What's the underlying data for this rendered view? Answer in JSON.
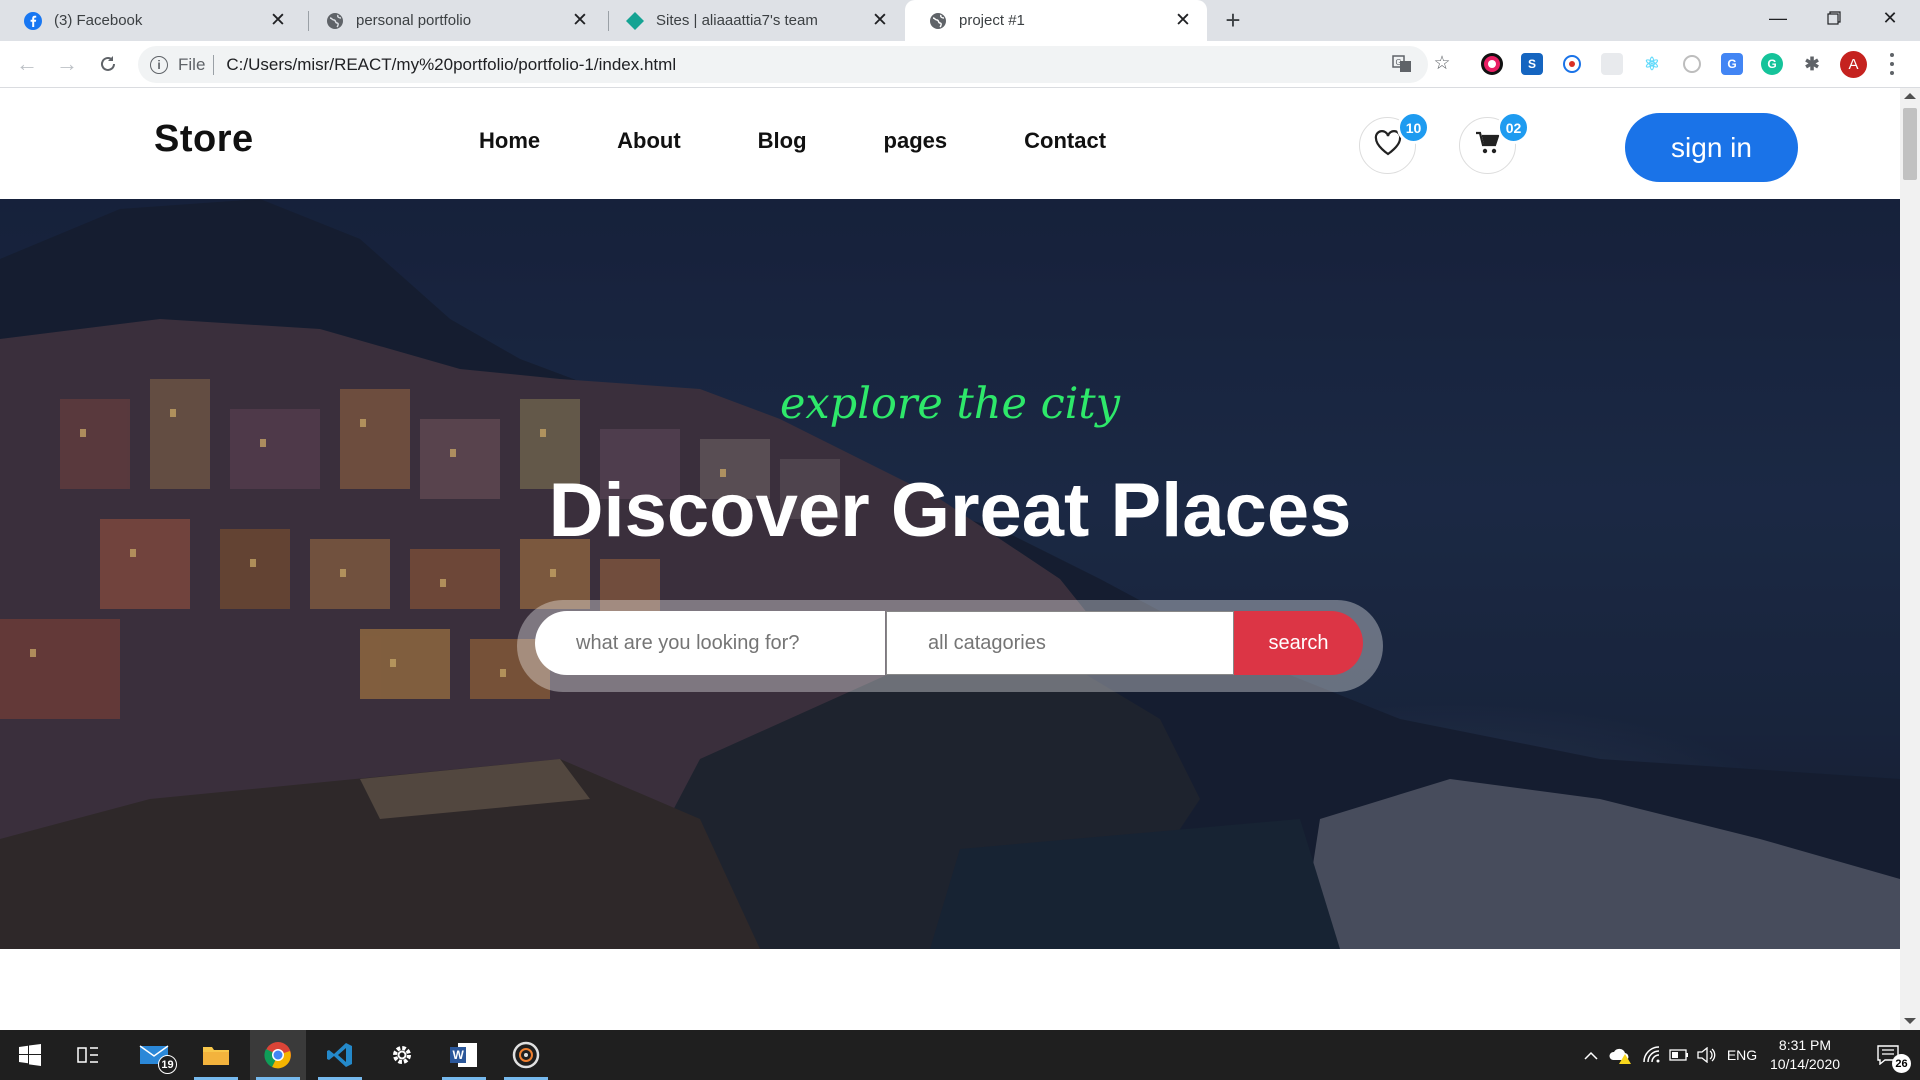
{
  "browser": {
    "tabs": [
      {
        "title": "(3) Facebook",
        "icon": "facebook-icon",
        "active": false
      },
      {
        "title": "personal portfolio",
        "icon": "globe-icon",
        "active": false
      },
      {
        "title": "Sites | aliaaattia7's team",
        "icon": "netlify-icon",
        "active": false
      },
      {
        "title": "project #1",
        "icon": "globe-icon",
        "active": true
      }
    ],
    "new_tab": "+",
    "address": {
      "scheme": "File",
      "url": "C:/Users/misr/REACT/my%20portfolio/portfolio-1/index.html"
    },
    "profile_initial": "A"
  },
  "site": {
    "logo": "Store",
    "nav": [
      "Home",
      "About",
      "Blog",
      "pages",
      "Contact"
    ],
    "wishlist_count": "10",
    "cart_count": "02",
    "signin_label": "sign in"
  },
  "hero": {
    "tagline": "explore the city",
    "headline": "Discover Great Places",
    "search_placeholder": "what are you looking for?",
    "category_label": "all catagories",
    "search_button": "search"
  },
  "colors": {
    "tagline": "#2ee86a",
    "primary": "#1a73e8",
    "badge": "#1e9bf0",
    "search_button": "#dc3545"
  },
  "taskbar": {
    "mail_badge": "19",
    "language": "ENG",
    "time": "8:31 PM",
    "date": "10/14/2020",
    "notifications": "26"
  }
}
